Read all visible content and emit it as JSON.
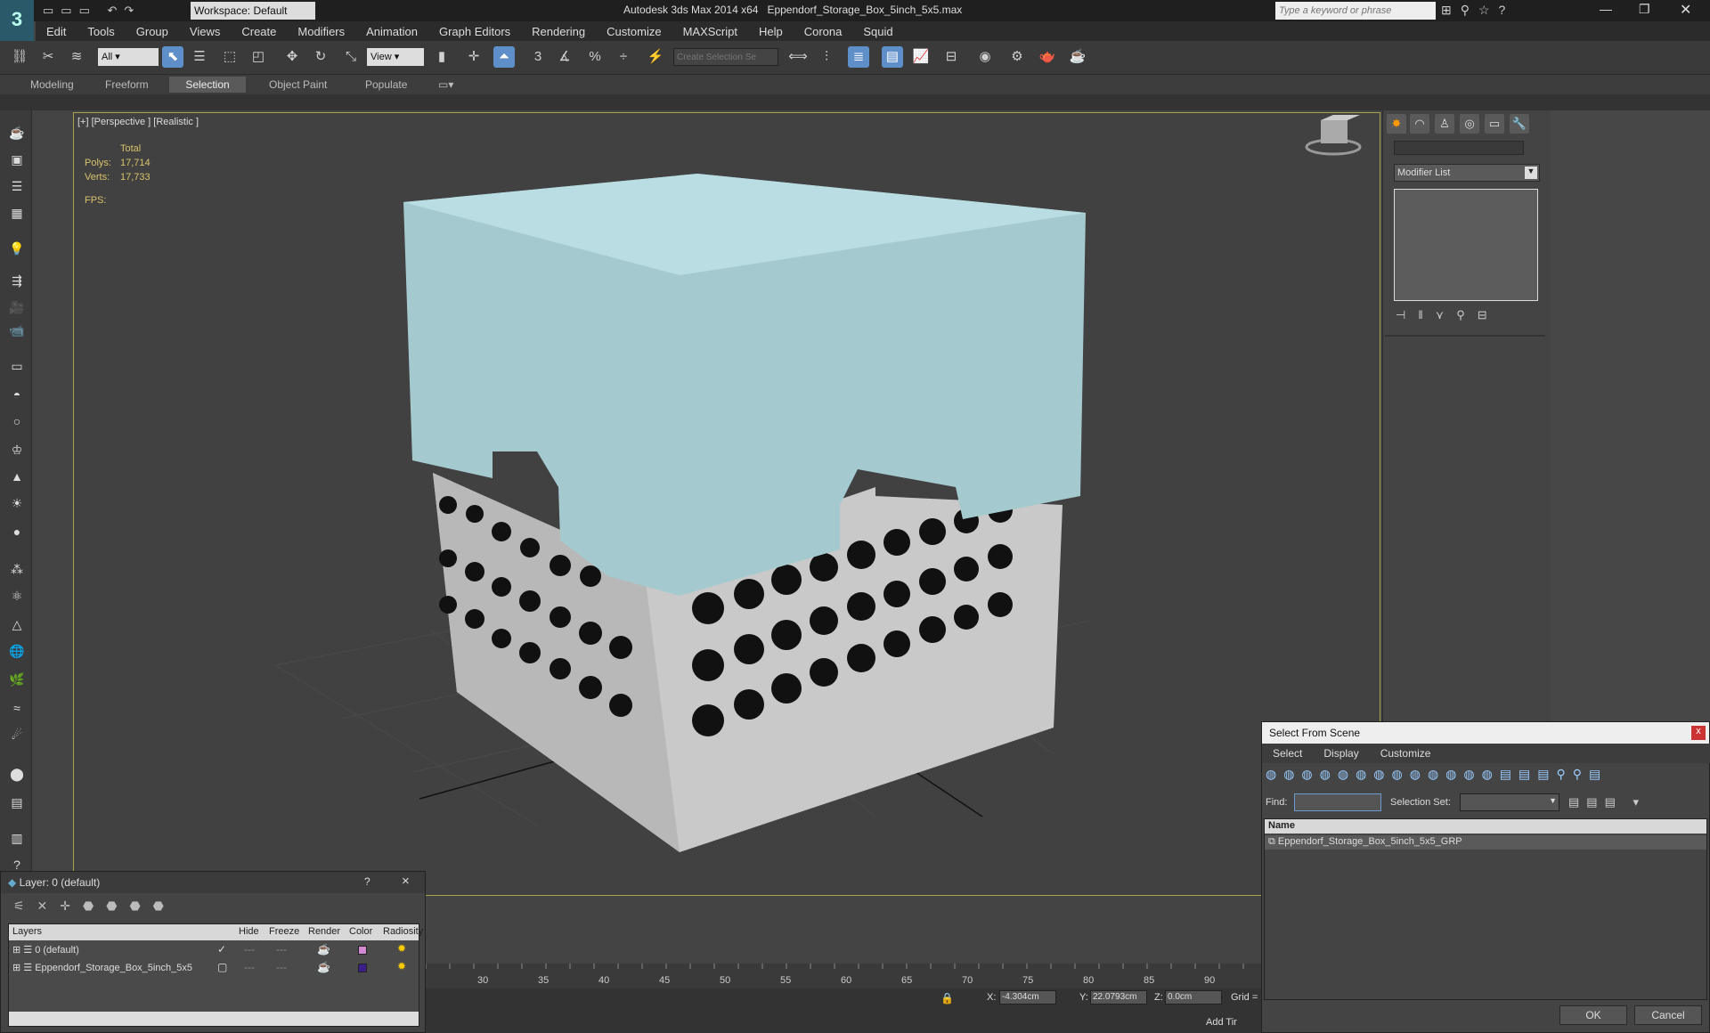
{
  "app": {
    "title": "Autodesk 3ds Max  2014 x64",
    "file": "Eppendorf_Storage_Box_5inch_5x5.max",
    "workspace": "Workspace: Default",
    "search_placeholder": "Type a keyword or phrase"
  },
  "menu": [
    "Edit",
    "Tools",
    "Group",
    "Views",
    "Create",
    "Modifiers",
    "Animation",
    "Graph Editors",
    "Rendering",
    "Customize",
    "MAXScript",
    "Help",
    "Corona",
    "Squid"
  ],
  "toolbar": {
    "filter": "All",
    "refcoord": "View",
    "selection_set_placeholder": "Create Selection Se"
  },
  "ribbon": {
    "tabs": [
      "Modeling",
      "Freeform",
      "Selection",
      "Object Paint",
      "Populate"
    ],
    "active": "Selection"
  },
  "viewport": {
    "label": "[+] [Perspective ] [Realistic ]",
    "stats": {
      "header": "Total",
      "polys_label": "Polys:",
      "polys": "17,714",
      "verts_label": "Verts:",
      "verts": "17,733",
      "fps_label": "FPS:"
    }
  },
  "cmd": {
    "modifier_list": "Modifier List"
  },
  "layer": {
    "title": "Layer: 0 (default)",
    "help": "?",
    "close": "×",
    "cols": [
      "Layers",
      "Hide",
      "Freeze",
      "Render",
      "Color",
      "Radiosity"
    ],
    "rows": [
      {
        "name": "0 (default)",
        "color": "#d38ad3"
      },
      {
        "name": "Eppendorf_Storage_Box_5inch_5x5",
        "color": "#3b1f8c"
      }
    ]
  },
  "select": {
    "title": "Select From Scene",
    "close": "x",
    "menus": [
      "Select",
      "Display",
      "Customize"
    ],
    "find": "Find:",
    "selset": "Selection Set:",
    "col_name": "Name",
    "items": [
      "Eppendorf_Storage_Box_5inch_5x5_GRP"
    ],
    "ok": "OK",
    "cancel": "Cancel"
  },
  "timeline": {
    "ticks": [
      "30",
      "35",
      "40",
      "45",
      "50",
      "55",
      "60",
      "65",
      "70",
      "75",
      "80",
      "85",
      "90"
    ]
  },
  "status": {
    "x_label": "X:",
    "x": "-4.304cm",
    "y_label": "Y:",
    "y": "22.0793cm",
    "z_label": "Z:",
    "z": "0.0cm",
    "grid": "Grid =",
    "addtime": "Add Tir"
  }
}
